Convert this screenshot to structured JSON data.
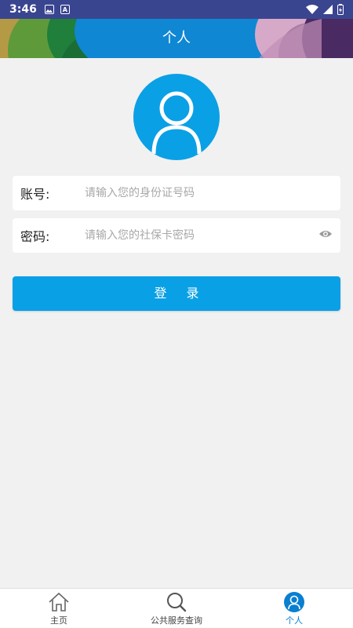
{
  "status_bar": {
    "time": "3:46",
    "icons": [
      "image-icon",
      "a-text-icon",
      "wifi-icon",
      "signal-icon",
      "battery-icon"
    ]
  },
  "header": {
    "title": "个人"
  },
  "login_form": {
    "account": {
      "label": "账号:",
      "placeholder": "请输入您的身份证号码",
      "value": ""
    },
    "password": {
      "label": "密码:",
      "placeholder": "请输入您的社保卡密码",
      "value": ""
    },
    "submit_label": "登 录"
  },
  "tab_bar": {
    "tabs": [
      {
        "label": "主页",
        "icon": "home-icon",
        "active": false
      },
      {
        "label": "公共服务查询",
        "icon": "search-icon",
        "active": false
      },
      {
        "label": "个人",
        "icon": "person-icon",
        "active": true
      }
    ]
  },
  "colors": {
    "status_bar": "#3a4590",
    "header_blue": "#0f87d3",
    "primary": "#0aa0e6",
    "background": "#f1f1f1",
    "active_tab": "#0a7fd0"
  }
}
